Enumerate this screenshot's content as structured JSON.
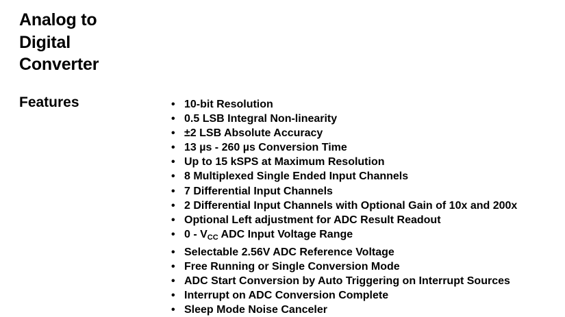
{
  "section": {
    "title_lines": [
      "Analog to",
      "Digital",
      "Converter"
    ]
  },
  "features": {
    "heading": "Features",
    "bullet": "•",
    "items": [
      "10-bit Resolution",
      "0.5 LSB Integral Non-linearity",
      "±2 LSB Absolute Accuracy",
      "13 µs - 260 µs Conversion Time",
      "Up to 15 kSPS at Maximum Resolution",
      "8 Multiplexed Single Ended Input Channels",
      "7 Differential Input Channels",
      "2 Differential Input Channels with Optional Gain of 10x and 200x",
      "Optional Left adjustment for ADC Result Readout",
      {
        "prefix": "0 - V",
        "subscript": "CC",
        "suffix": " ADC Input Voltage Range"
      },
      "Selectable 2.56V ADC Reference Voltage",
      "Free Running or Single Conversion Mode",
      "ADC Start Conversion by Auto Triggering on Interrupt Sources",
      "Interrupt on ADC Conversion Complete",
      "Sleep Mode Noise Canceler"
    ]
  }
}
